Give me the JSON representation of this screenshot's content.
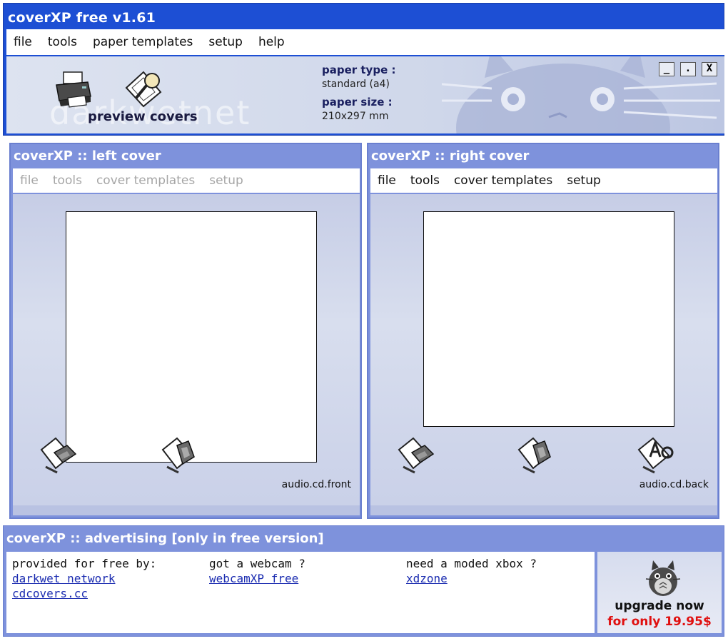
{
  "app": {
    "title": "coverXP free v1.61",
    "menu": [
      "file",
      "tools",
      "paper templates",
      "setup",
      "help"
    ],
    "watermark": "darkwetnet",
    "toolbar": {
      "preview_label": "preview covers"
    },
    "paper": {
      "type_label": "paper type :",
      "type_value": "standard (a4)",
      "size_label": "paper size :",
      "size_value": "210x297 mm"
    },
    "window_buttons": {
      "minimize": "_",
      "restore": ".",
      "close": "X"
    }
  },
  "left_cover": {
    "title": "coverXP :: left cover",
    "menu": [
      "file",
      "tools",
      "cover templates",
      "setup"
    ],
    "menu_state": "disabled",
    "template_label": "audio.cd.front"
  },
  "right_cover": {
    "title": "coverXP :: right cover",
    "menu": [
      "file",
      "tools",
      "cover templates",
      "setup"
    ],
    "template_label": "audio.cd.back"
  },
  "advertising": {
    "title": "coverXP ::  advertising [only in free version]",
    "columns": [
      {
        "heading": "provided for free by:",
        "links": [
          "darkwet network",
          "cdcovers.cc"
        ]
      },
      {
        "heading": "got a webcam ?",
        "links": [
          "webcamXP free"
        ]
      },
      {
        "heading": "need a moded xbox ?",
        "links": [
          "xdzone"
        ]
      }
    ],
    "upgrade": {
      "label": "upgrade now",
      "price": "for only 19.95$"
    }
  },
  "colors": {
    "title_bar": "#1d4fd4",
    "panel": "#7e92dc",
    "link": "#1a2bb0",
    "price": "#e01010"
  }
}
